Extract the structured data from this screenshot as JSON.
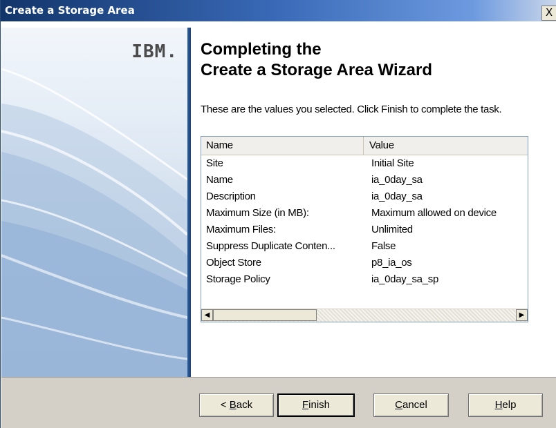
{
  "window": {
    "title": "Create a Storage Area",
    "close_label": "X"
  },
  "side_panel": {
    "logo": "IBM."
  },
  "heading": {
    "line1": "Completing the",
    "line2": "Create a Storage Area Wizard"
  },
  "instructions": "These are the values you selected. Click Finish to complete the task.",
  "summary_table": {
    "columns": [
      "Name",
      "Value"
    ],
    "rows": [
      {
        "name": "Site",
        "value": "Initial Site"
      },
      {
        "name": "Name",
        "value": "ia_0day_sa"
      },
      {
        "name": "Description",
        "value": "ia_0day_sa"
      },
      {
        "name": "Maximum Size (in MB):",
        "value": "Maximum allowed on device"
      },
      {
        "name": "Maximum Files:",
        "value": "Unlimited"
      },
      {
        "name": "Suppress Duplicate Conten...",
        "value": "False"
      },
      {
        "name": "Object Store",
        "value": "p8_ia_os"
      },
      {
        "name": "Storage Policy",
        "value": "ia_0day_sa_sp"
      }
    ]
  },
  "buttons": {
    "back_prefix": "< ",
    "back_key": "B",
    "back_rest": "ack",
    "finish_key": "F",
    "finish_rest": "inish",
    "cancel_key": "C",
    "cancel_rest": "ancel",
    "help_key": "H",
    "help_rest": "elp"
  },
  "colors": {
    "title_bar_start": "#12356a",
    "title_bar_end": "#c9d6ea",
    "side_panel": "#cfdcec",
    "divider": "#2f5f9e",
    "footer": "#d4d0c8"
  }
}
